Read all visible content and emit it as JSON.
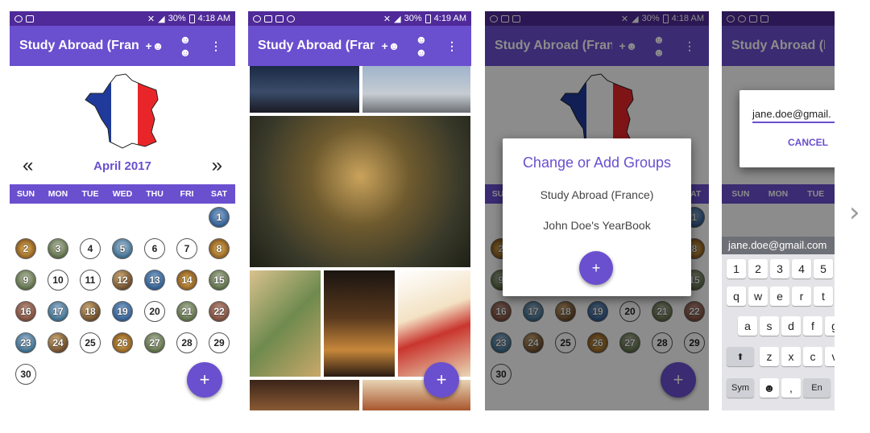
{
  "status_bar": {
    "battery": "30%",
    "time_a": "4:18 AM",
    "time_b": "4:19 AM"
  },
  "app": {
    "title": "Study Abroad (Franc…",
    "actions": [
      "person-add-icon",
      "group-icon",
      "more-vert-icon"
    ]
  },
  "calendar": {
    "prev_label": "«",
    "next_label": "»",
    "month": "April 2017",
    "weekdays": [
      "SUN",
      "MON",
      "TUE",
      "WED",
      "THU",
      "FRI",
      "SAT"
    ],
    "days": [
      "1",
      "2",
      "3",
      "4",
      "5",
      "6",
      "7",
      "8",
      "9",
      "10",
      "11",
      "12",
      "13",
      "14",
      "15",
      "16",
      "17",
      "18",
      "19",
      "20",
      "21",
      "22",
      "23",
      "24",
      "25",
      "26",
      "27",
      "28",
      "29",
      "30"
    ]
  },
  "fab_label": "+",
  "dialog": {
    "title": "Change or Add Groups",
    "items": [
      "Study Abroad (France)",
      "John Doe's YearBook"
    ],
    "add_label": "+"
  },
  "email_dialog": {
    "value": "jane.doe@gmail.",
    "cancel": "CANCEL",
    "suggestion": "jane.doe@gmail.com"
  },
  "keyboard": {
    "numbers": [
      "1",
      "2",
      "3",
      "4",
      "5"
    ],
    "row1": [
      "q",
      "w",
      "e",
      "r",
      "t"
    ],
    "row2": [
      "a",
      "s",
      "d",
      "f",
      "g"
    ],
    "row3": [
      "z",
      "x",
      "c",
      "v"
    ],
    "shift": "⬆",
    "sym": "Sym",
    "emoji": "☻",
    "comma": ",",
    "enter": "En"
  },
  "carousel_next": "›",
  "colors": {
    "accent": "#6a4fcf",
    "status_bar": "#4f2a98"
  }
}
